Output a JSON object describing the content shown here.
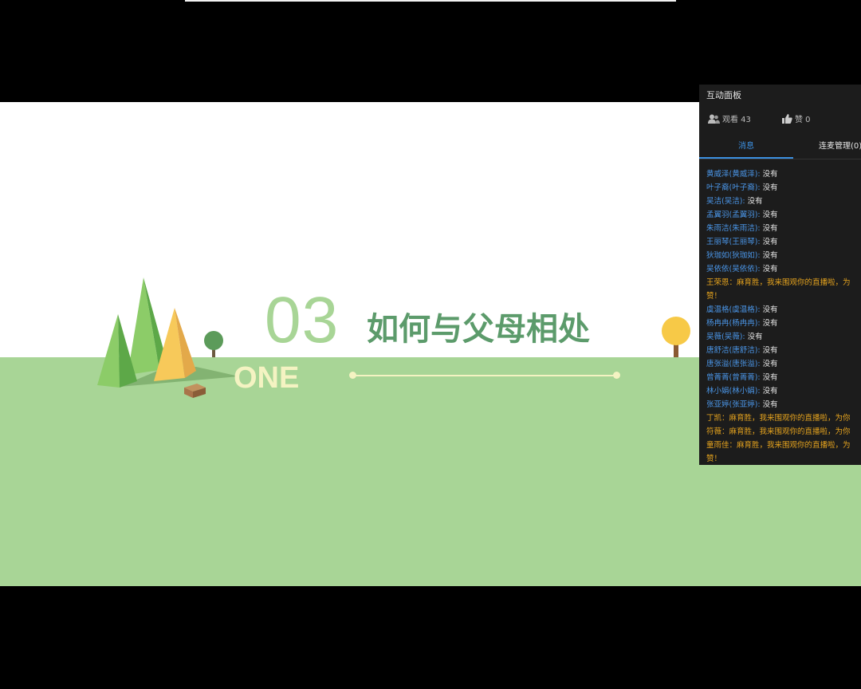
{
  "slide": {
    "number": "03",
    "title": "如何与父母相处",
    "subtitle": "ONE"
  },
  "panel": {
    "title": "互动面板",
    "viewers_label": "观看 43",
    "likes_label": "赞 0",
    "tabs": [
      "消息",
      "连麦管理(0)"
    ],
    "messages": [
      {
        "user": "黄威泽(黄威泽):",
        "text": " 没有",
        "type": "chat"
      },
      {
        "user": "叶子裔(叶子裔):",
        "text": " 没有",
        "type": "chat"
      },
      {
        "user": "吴洁(吴洁):",
        "text": " 没有",
        "type": "chat"
      },
      {
        "user": "孟翼羽(孟翼羽):",
        "text": " 没有",
        "type": "chat"
      },
      {
        "user": "朱雨洁(朱雨洁):",
        "text": " 没有",
        "type": "chat"
      },
      {
        "user": "王丽琴(王丽琴):",
        "text": " 没有",
        "type": "chat"
      },
      {
        "user": "狄珈如(狄珈如):",
        "text": " 没有",
        "type": "chat"
      },
      {
        "user": "吴依依(吴依依):",
        "text": " 没有",
        "type": "chat"
      },
      {
        "user": "",
        "text": "王荣恩：麻育胜，我来围观你的直播啦，为",
        "type": "gift"
      },
      {
        "user": "",
        "text": "赞！",
        "type": "gift"
      },
      {
        "user": "虞温格(虞温格):",
        "text": " 没有",
        "type": "chat"
      },
      {
        "user": "杨冉冉(杨冉冉):",
        "text": " 没有",
        "type": "chat"
      },
      {
        "user": "吴薇(吴薇):",
        "text": " 没有",
        "type": "chat"
      },
      {
        "user": "唐舒洁(唐舒洁):",
        "text": " 没有",
        "type": "chat"
      },
      {
        "user": "唐张溢(唐张溢):",
        "text": " 没有",
        "type": "chat"
      },
      {
        "user": "曾菁菁(曾菁菁):",
        "text": " 没有",
        "type": "chat"
      },
      {
        "user": "林小娟(林小娟):",
        "text": " 没有",
        "type": "chat"
      },
      {
        "user": "张亚婷(张亚婷):",
        "text": " 没有",
        "type": "chat"
      },
      {
        "user": "",
        "text": "丁凯：麻育胜，我来围观你的直播啦，为你",
        "type": "gift"
      },
      {
        "user": "",
        "text": "符薇：麻育胜，我来围观你的直播啦，为你",
        "type": "gift"
      },
      {
        "user": "",
        "text": "童雨佳：麻育胜，我来围观你的直播啦，为",
        "type": "gift"
      },
      {
        "user": "",
        "text": "赞！",
        "type": "gift"
      }
    ]
  },
  "colors": {
    "grass": "#a8d596",
    "title_green": "#5c9b6b",
    "panel_bg": "#1c1c1c",
    "link_blue": "#4a95e6",
    "gift_orange": "#e5a31e"
  }
}
